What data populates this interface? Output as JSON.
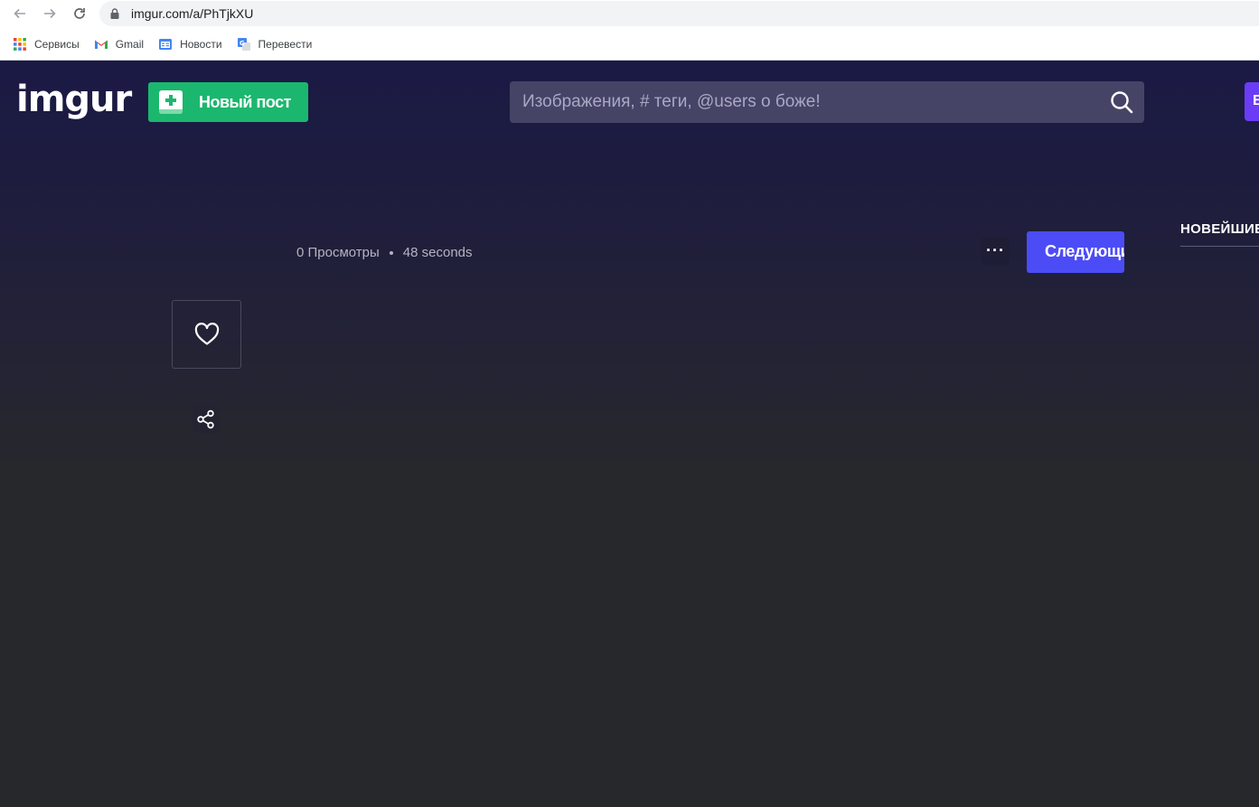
{
  "browser": {
    "url": "imgur.com/a/PhTjkXU",
    "bookmarks": [
      {
        "label": "Сервисы",
        "icon": "apps-grid-icon"
      },
      {
        "label": "Gmail",
        "icon": "gmail-icon"
      },
      {
        "label": "Новости",
        "icon": "google-news-icon"
      },
      {
        "label": "Перевести",
        "icon": "google-translate-icon"
      }
    ]
  },
  "header": {
    "logo": "imgur",
    "new_post_label": "Новый пост",
    "search_placeholder": "Изображения, # теги, @users о боже!",
    "edge_button_label": "В"
  },
  "post": {
    "views": "0 Просмотры",
    "time": "48 seconds",
    "more_label": "···",
    "next_label": "Следующий"
  },
  "sidebar": {
    "newest_tab": "НОВЕЙШИЕ"
  },
  "colors": {
    "brand_green": "#1bb76e",
    "accent_blue": "#4c4cf7",
    "accent_purple": "#6b3cf5",
    "header_bg": "#1b1a45",
    "page_bg": "#27282c"
  }
}
